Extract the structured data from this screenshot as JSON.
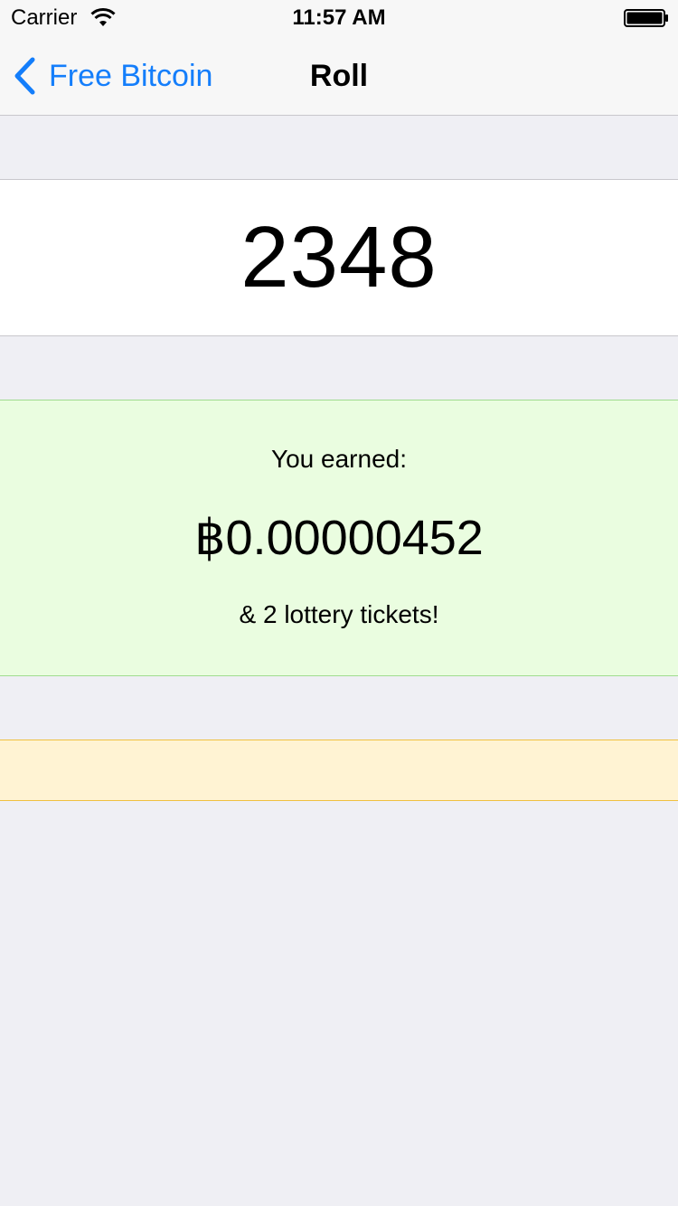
{
  "status_bar": {
    "carrier": "Carrier",
    "time": "11:57 AM",
    "wifi_icon": "wifi-icon",
    "battery_icon": "battery-icon"
  },
  "nav": {
    "back_label": "Free Bitcoin",
    "back_icon": "chevron-left-icon",
    "title": "Roll"
  },
  "roll": {
    "number": "2348"
  },
  "earned": {
    "label": "You earned:",
    "amount": "฿0.00000452",
    "tickets": "& 2 lottery tickets!"
  },
  "colors": {
    "accent": "#147efb",
    "background": "#efeff4",
    "earned_background": "#eafde0",
    "earned_border": "#9fdc8f",
    "notice_background": "#fff3d3",
    "notice_border": "#f0c040"
  }
}
